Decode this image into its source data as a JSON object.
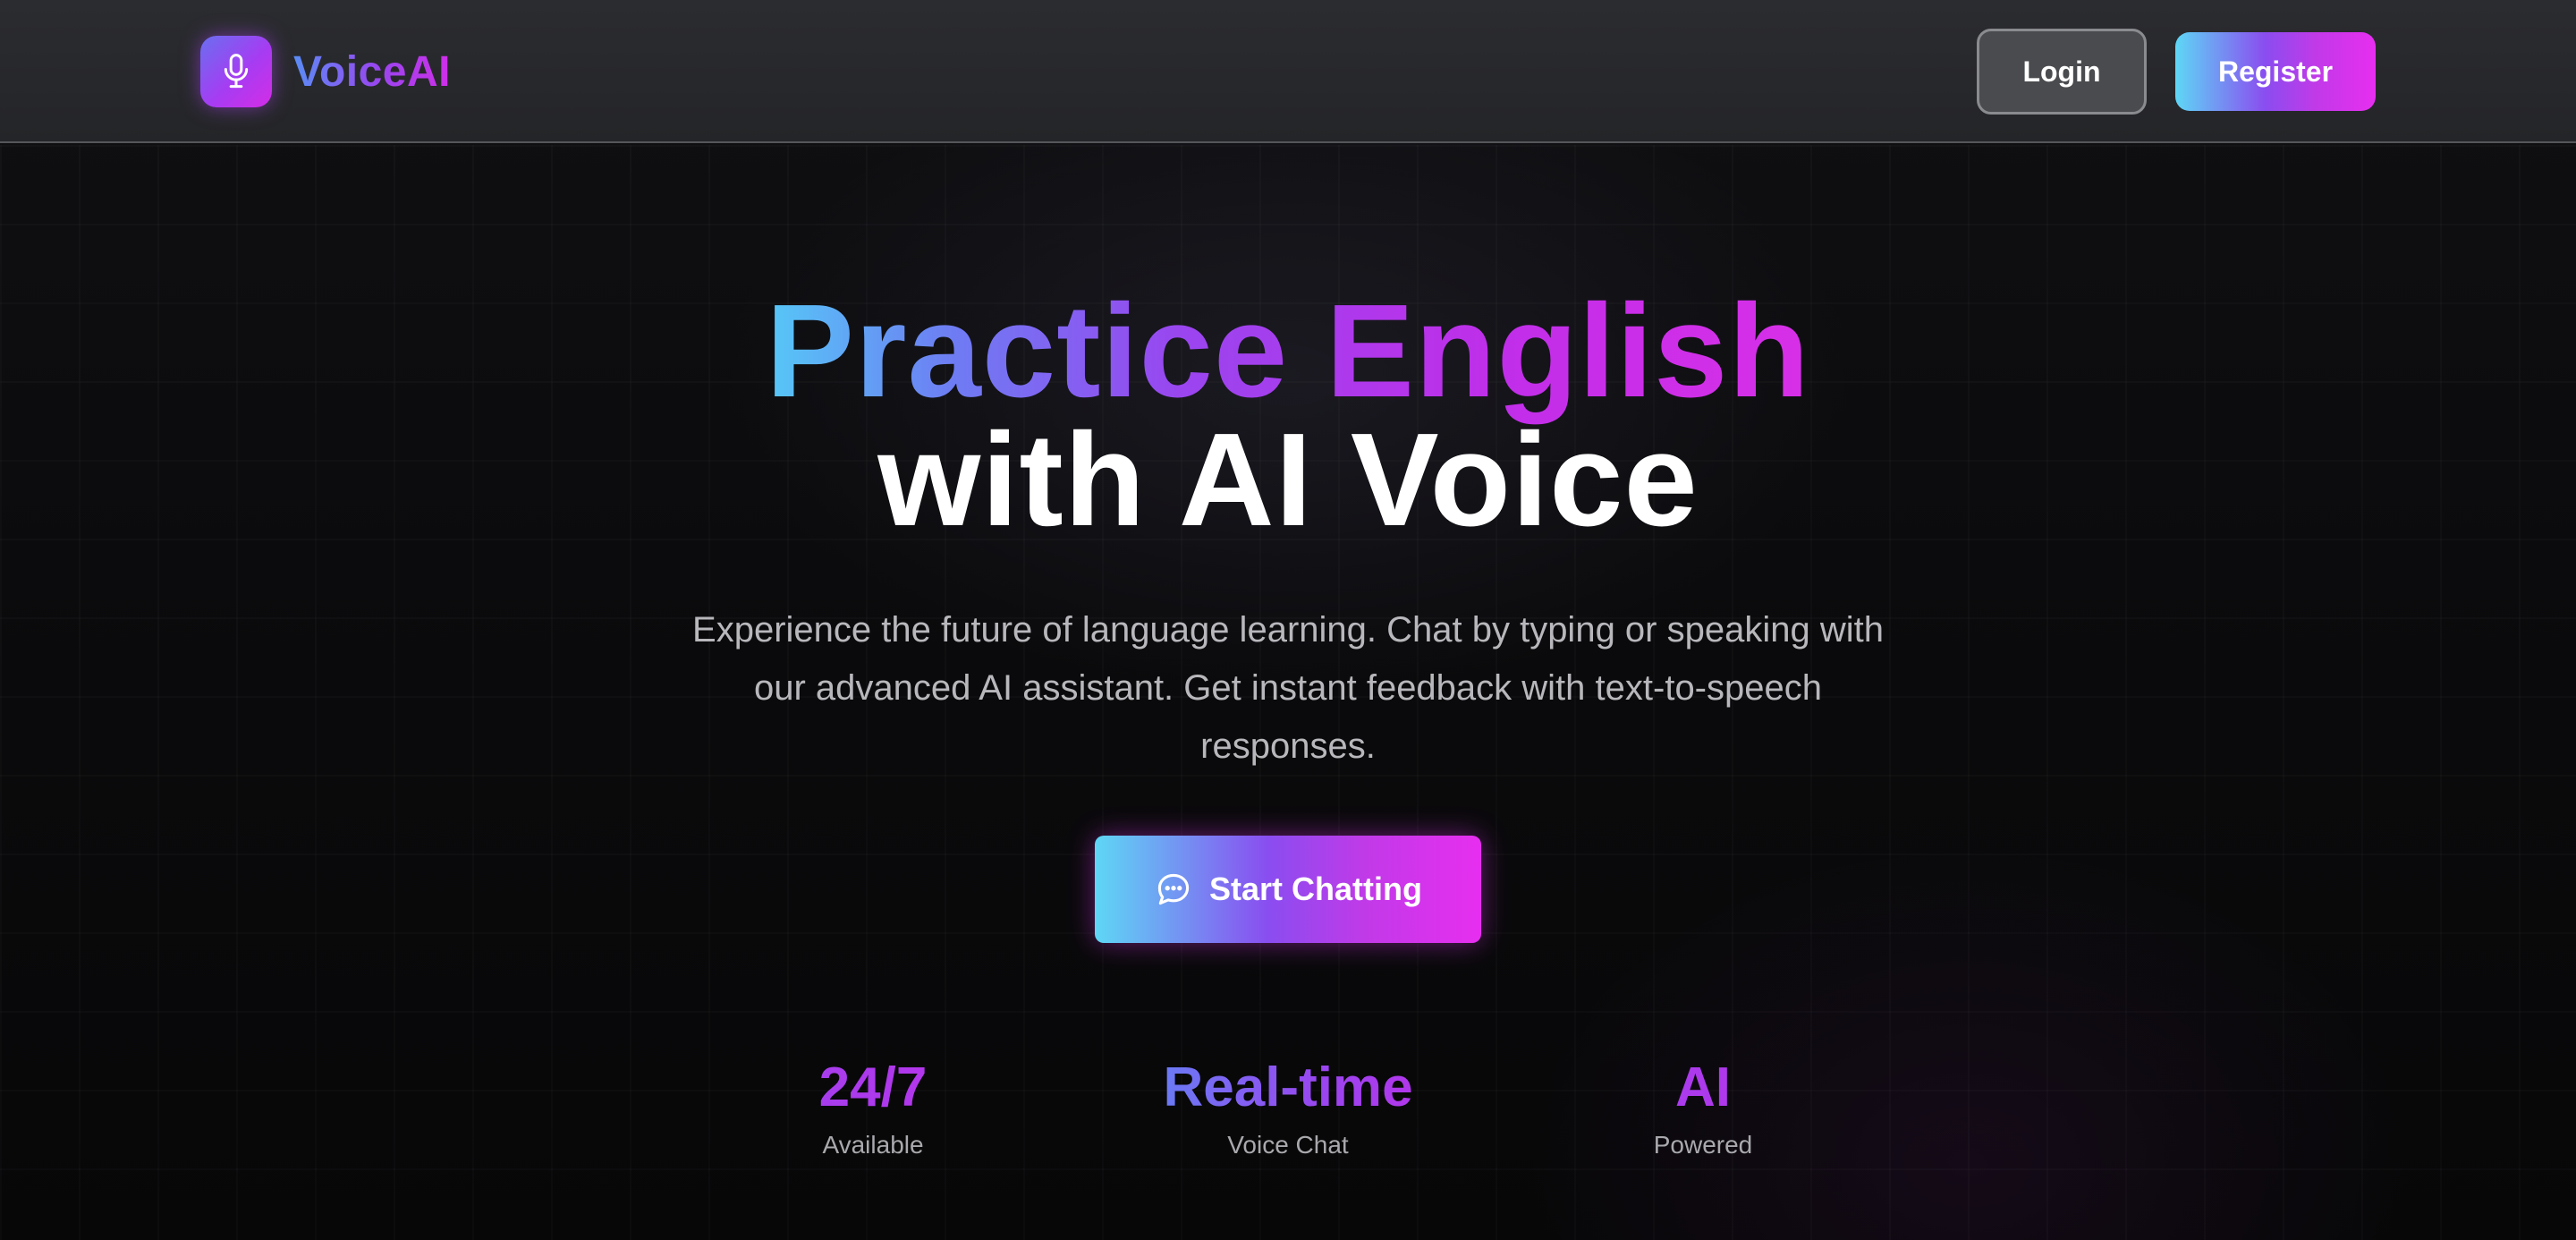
{
  "header": {
    "brand_name": "VoiceAI",
    "logo_icon": "microphone-icon",
    "login_label": "Login",
    "register_label": "Register"
  },
  "hero": {
    "title_line1": "Practice English",
    "title_line2": "with AI Voice",
    "subtitle": "Experience the future of language learning. Chat by typing or speaking with our advanced AI assistant. Get instant feedback with text-to-speech responses.",
    "cta_label": "Start Chatting",
    "cta_icon": "chat-bubble-icon"
  },
  "stats": [
    {
      "value": "24/7",
      "label": "Available"
    },
    {
      "value": "Real-time",
      "label": "Voice Chat"
    },
    {
      "value": "AI",
      "label": "Powered"
    }
  ],
  "colors": {
    "gradient_start": "#5ed7f5",
    "gradient_mid": "#8a4df0",
    "gradient_end": "#e72ef0",
    "background": "#0a0a0c",
    "header_bg": "#2b2c30"
  }
}
